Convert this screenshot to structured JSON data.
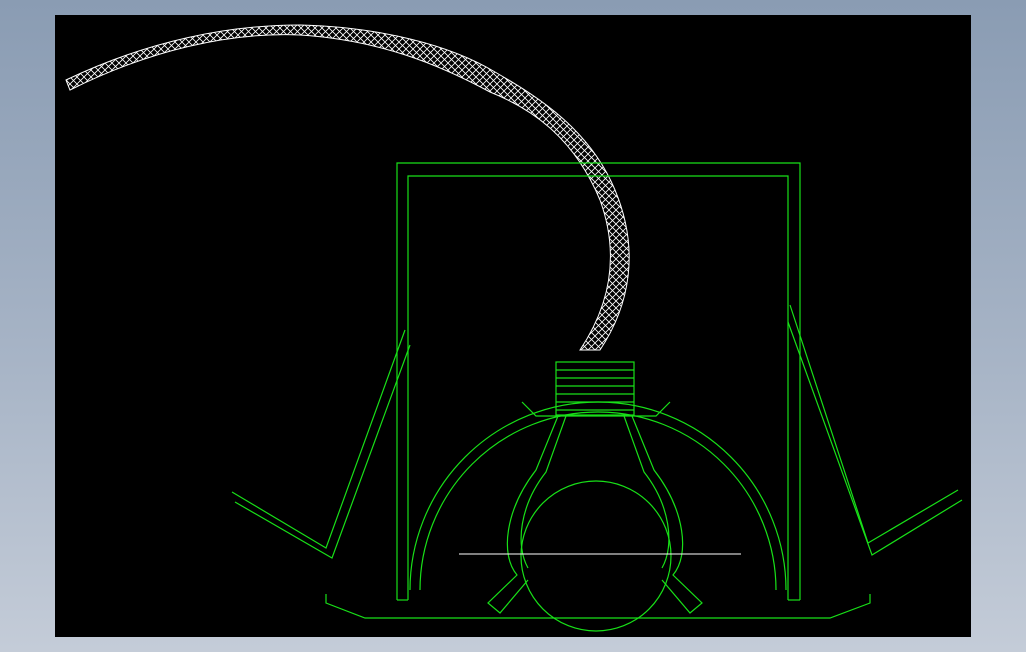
{
  "window": {
    "background_gradient": [
      "#8a9cb3",
      "#c4ccd8"
    ]
  },
  "canvas": {
    "background_color": "#000000"
  },
  "colors": {
    "primary_stroke": "#18e018",
    "accent_stroke": "#ffffff",
    "hatch_stroke": "#ffffff"
  },
  "drawing": {
    "entities": [
      "conduit-hose",
      "frame-enclosure",
      "left-chute",
      "right-chute",
      "outer-semicircle-housing",
      "inner-semicircle-housing",
      "clamp-bracket",
      "inner-pipe-circle",
      "horizontal-reference-line",
      "base-tray"
    ]
  }
}
